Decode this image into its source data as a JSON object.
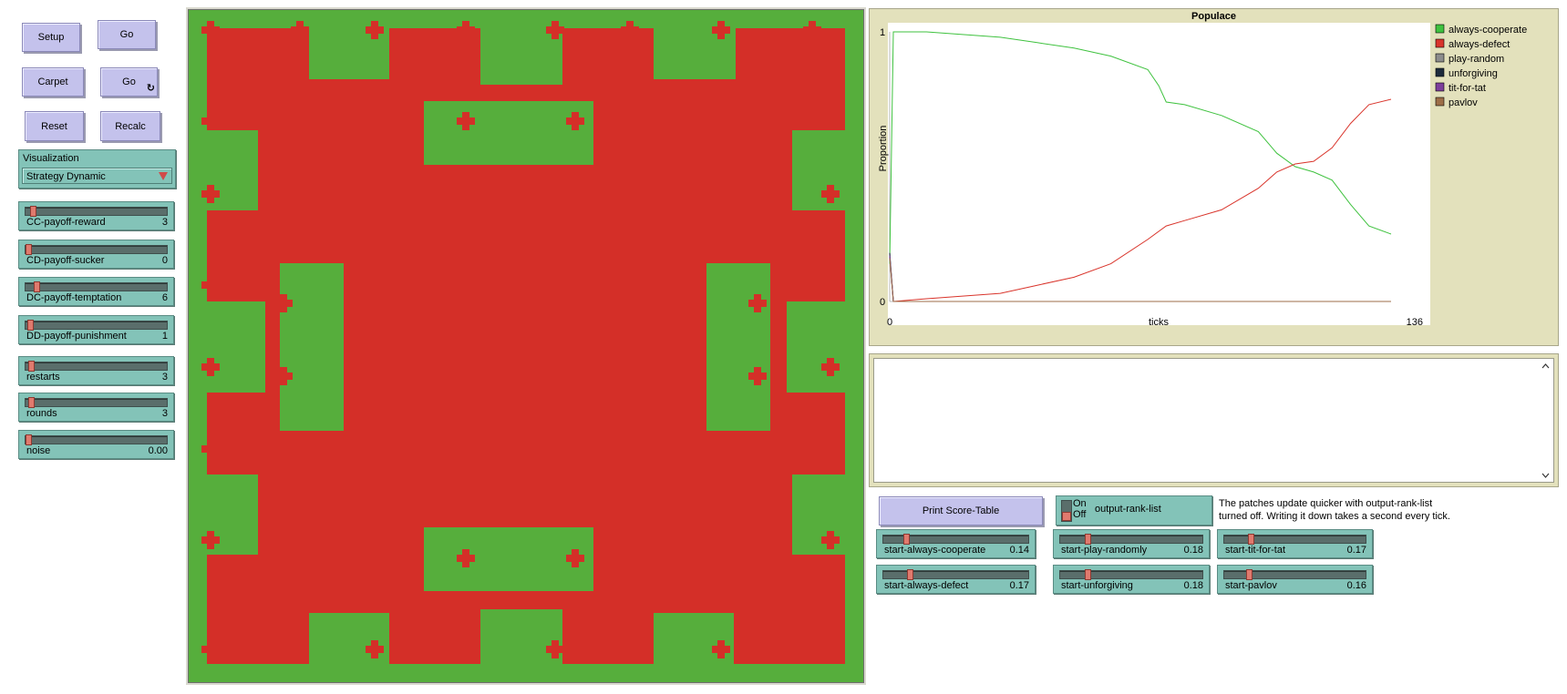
{
  "buttons": {
    "setup": "Setup",
    "go": "Go",
    "carpet": "Carpet",
    "go_forever": "Go",
    "forever_icon": "↻",
    "reset": "Reset",
    "recalc": "Recalc",
    "print_score_table": "Print Score-Table"
  },
  "visualization": {
    "label": "Visualization",
    "selected": "Strategy Dynamic"
  },
  "sliders_left": [
    {
      "name": "CC-payoff-reward",
      "value": "3",
      "fraction": 0.03
    },
    {
      "name": "CD-payoff-sucker",
      "value": "0",
      "fraction": 0.0
    },
    {
      "name": "DC-payoff-temptation",
      "value": "6",
      "fraction": 0.06
    },
    {
      "name": "DD-payoff-punishment",
      "value": "1",
      "fraction": 0.01
    },
    {
      "name": "restarts",
      "value": "3",
      "fraction": 0.02
    },
    {
      "name": "rounds",
      "value": "3",
      "fraction": 0.02
    },
    {
      "name": "noise",
      "value": "0.00",
      "fraction": 0.0
    }
  ],
  "sliders_bottom": [
    {
      "name": "start-always-cooperate",
      "value": "0.14",
      "fraction": 0.14
    },
    {
      "name": "start-always-defect",
      "value": "0.17",
      "fraction": 0.17
    },
    {
      "name": "start-play-randomly",
      "value": "0.18",
      "fraction": 0.18
    },
    {
      "name": "start-unforgiving",
      "value": "0.18",
      "fraction": 0.18
    },
    {
      "name": "start-tit-for-tat",
      "value": "0.17",
      "fraction": 0.17
    },
    {
      "name": "start-pavlov",
      "value": "0.16",
      "fraction": 0.16
    }
  ],
  "switch": {
    "on": "On",
    "off": "Off",
    "name": "output-rank-list"
  },
  "note": {
    "line1": "The patches update quicker with output-rank-list",
    "line2": "turned off. Writing it down takes a second every tick."
  },
  "world_colors": {
    "cooperate": "#56ae3c",
    "defect": "#d42f28"
  },
  "chart_data": {
    "type": "line",
    "title": "Populace",
    "xlabel": "ticks",
    "ylabel": "Proportion",
    "xlim": [
      0,
      136
    ],
    "ylim": [
      0,
      1
    ],
    "x_tick_labels": [
      "0",
      "136"
    ],
    "y_tick_labels": [
      "0",
      "1"
    ],
    "legend_position": "right",
    "series": [
      {
        "name": "always-cooperate",
        "color": "#3fc23f",
        "points": [
          [
            0,
            0.14
          ],
          [
            1,
            1.0
          ],
          [
            10,
            1.0
          ],
          [
            30,
            0.98
          ],
          [
            40,
            0.96
          ],
          [
            50,
            0.94
          ],
          [
            60,
            0.91
          ],
          [
            70,
            0.86
          ],
          [
            73,
            0.8
          ],
          [
            75,
            0.74
          ],
          [
            80,
            0.73
          ],
          [
            90,
            0.69
          ],
          [
            100,
            0.63
          ],
          [
            105,
            0.55
          ],
          [
            110,
            0.5
          ],
          [
            115,
            0.48
          ],
          [
            120,
            0.45
          ],
          [
            125,
            0.36
          ],
          [
            130,
            0.28
          ],
          [
            136,
            0.25
          ]
        ]
      },
      {
        "name": "always-defect",
        "color": "#d9342b",
        "points": [
          [
            0,
            0.17
          ],
          [
            1,
            0.0
          ],
          [
            10,
            0.01
          ],
          [
            30,
            0.03
          ],
          [
            40,
            0.06
          ],
          [
            50,
            0.09
          ],
          [
            60,
            0.14
          ],
          [
            70,
            0.23
          ],
          [
            73,
            0.26
          ],
          [
            75,
            0.28
          ],
          [
            80,
            0.3
          ],
          [
            90,
            0.34
          ],
          [
            100,
            0.42
          ],
          [
            105,
            0.48
          ],
          [
            110,
            0.51
          ],
          [
            115,
            0.52
          ],
          [
            120,
            0.57
          ],
          [
            125,
            0.66
          ],
          [
            130,
            0.73
          ],
          [
            136,
            0.75
          ]
        ]
      },
      {
        "name": "play-random",
        "color": "#8d8d8d",
        "points": [
          [
            0,
            0.18
          ],
          [
            1,
            0.0
          ],
          [
            136,
            0.0
          ]
        ]
      },
      {
        "name": "unforgiving",
        "color": "#1d2b3c",
        "points": [
          [
            0,
            0.18
          ],
          [
            1,
            0.0
          ],
          [
            136,
            0.0
          ]
        ]
      },
      {
        "name": "tit-for-tat",
        "color": "#7d3f9c",
        "points": [
          [
            0,
            0.17
          ],
          [
            1,
            0.0
          ],
          [
            136,
            0.0
          ]
        ]
      },
      {
        "name": "pavlov",
        "color": "#9d6e48",
        "points": [
          [
            0,
            0.16
          ],
          [
            1,
            0.0
          ],
          [
            136,
            0.0
          ]
        ]
      }
    ]
  }
}
